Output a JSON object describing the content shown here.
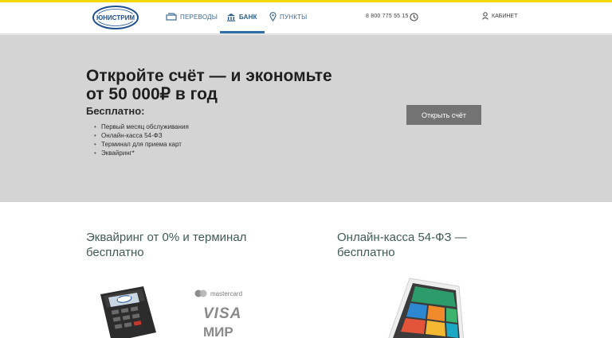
{
  "header": {
    "logo_text": "ЮНИСТРИМ",
    "nav": [
      {
        "label": "ПЕРЕВОДЫ",
        "icon": "transfer-icon",
        "active": false
      },
      {
        "label": "БАНК",
        "icon": "bank-icon",
        "active": true
      },
      {
        "label": "ПУНКТЫ",
        "icon": "location-pin-icon",
        "active": false
      }
    ],
    "phone": "8 800 775 55 15",
    "cabinet_label": "КАБИНЕТ",
    "accent_color": "#f3d700"
  },
  "hero": {
    "title": "Откройте счёт — и экономьте от 50 000₽ в год",
    "subtitle": "Бесплатно:",
    "items": [
      "Первый месяц обслуживания",
      "Онлайн-касса 54-ФЗ",
      "Терминал для приема карт",
      "Эквайринг*"
    ],
    "cta_label": "Открыть счёт"
  },
  "cards": [
    {
      "title": "Эквайринг от 0% и терминал бесплатно",
      "brands": [
        "mastercard",
        "VISA",
        "МИР"
      ]
    },
    {
      "title": "Онлайн-касса 54-ФЗ — бесплатно"
    }
  ]
}
